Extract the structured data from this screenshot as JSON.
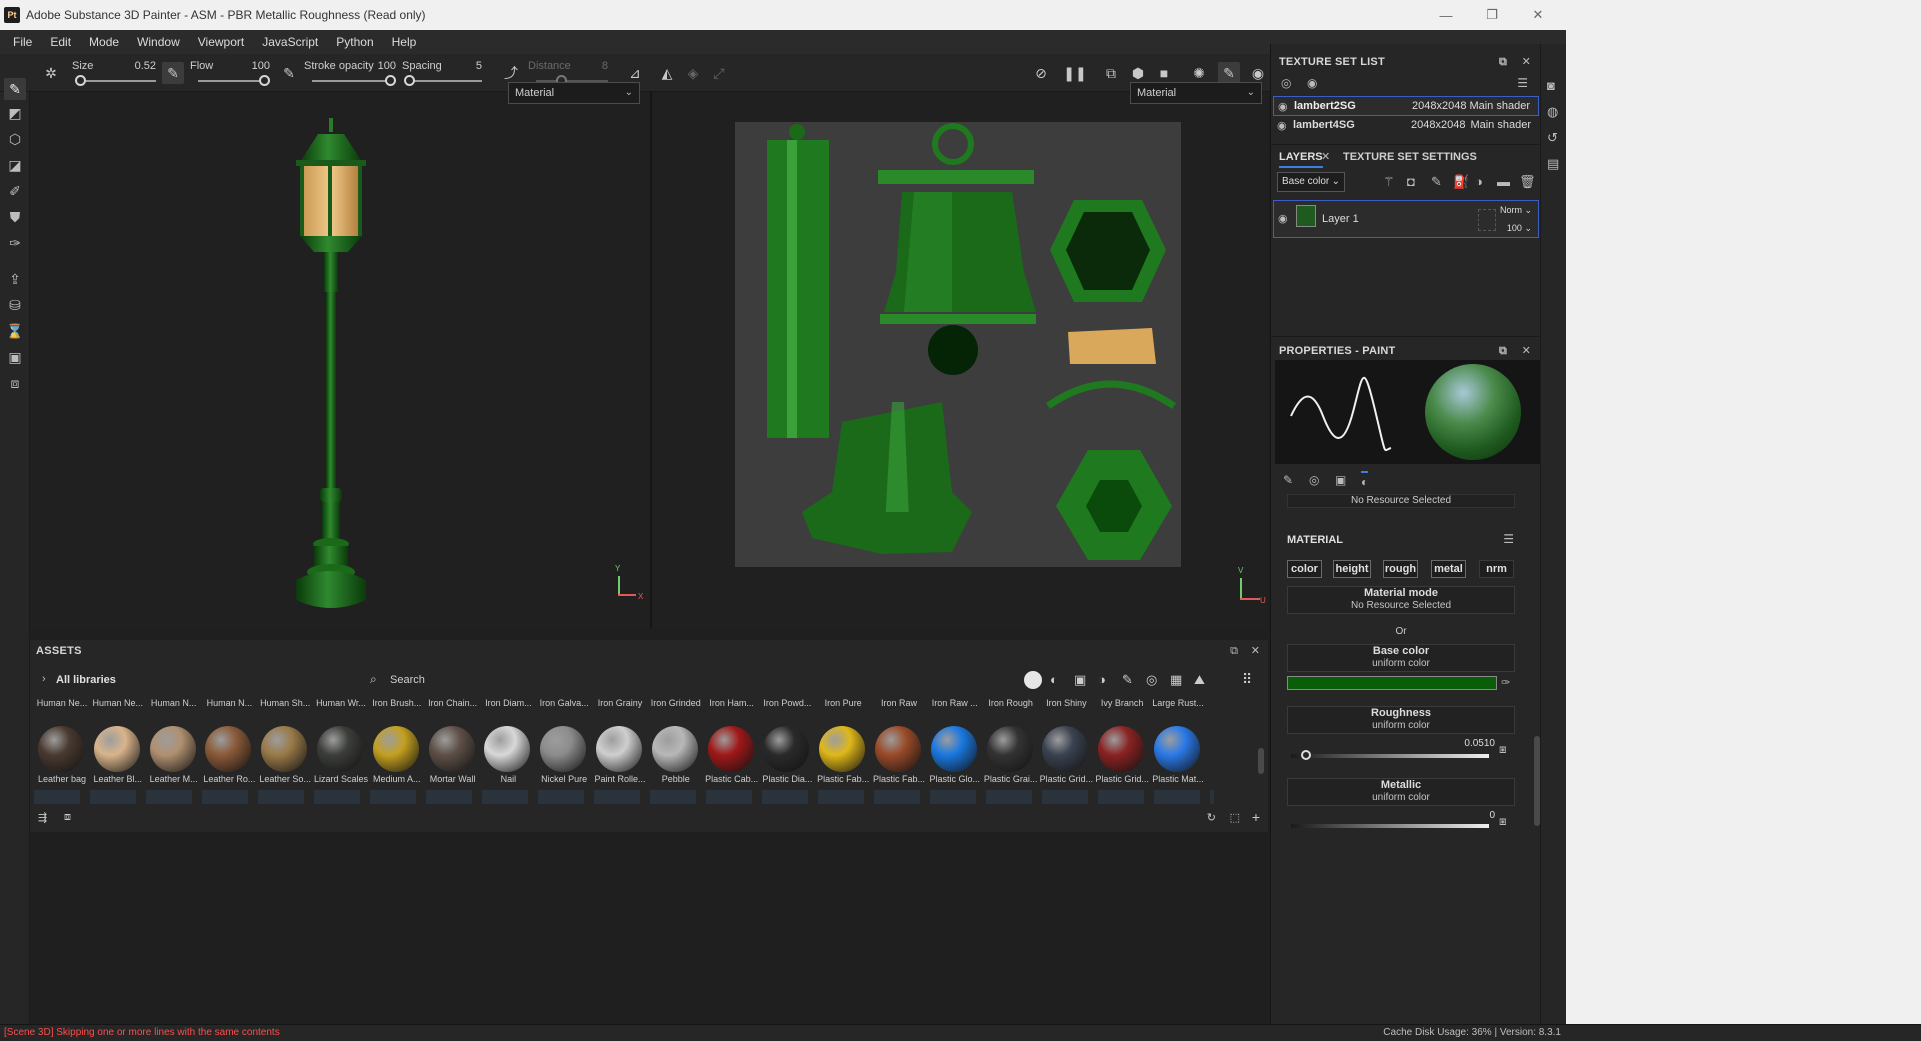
{
  "window": {
    "title": "Adobe Substance 3D Painter - ASM - PBR Metallic Roughness (Read only)",
    "logo": "Pt",
    "minimize": "—",
    "maximize": "❐",
    "close": "✕"
  },
  "menu": [
    "File",
    "Edit",
    "Mode",
    "Window",
    "Viewport",
    "JavaScript",
    "Python",
    "Help"
  ],
  "toolbar": {
    "size_label": "Size",
    "size_value": "0.52",
    "flow_label": "Flow",
    "flow_value": "100",
    "stroke_opacity_label": "Stroke opacity",
    "stroke_opacity_value": "100",
    "spacing_label": "Spacing",
    "spacing_value": "5",
    "distance_label": "Distance",
    "distance_value": "8"
  },
  "viewports": {
    "left_mode": "Material",
    "right_mode": "Material",
    "axis_y": "Y",
    "axis_x": "X",
    "axis_v": "V",
    "axis_u": "U"
  },
  "assets": {
    "title": "ASSETS",
    "library": "All libraries",
    "search_placeholder": "Search",
    "top_row": [
      "Human Ne...",
      "Human Ne...",
      "Human N...",
      "Human N...",
      "Human Sh...",
      "Human Wr...",
      "Iron Brush...",
      "Iron Chain...",
      "Iron Diam...",
      "Iron Galva...",
      "Iron Grainy",
      "Iron Grinded",
      "Iron Ham...",
      "Iron Powd...",
      "Iron Pure",
      "Iron Raw",
      "Iron Raw ...",
      "Iron Rough",
      "Iron Shiny",
      "Ivy Branch",
      "Large Rust..."
    ],
    "main_row": [
      {
        "name": "Leather bag",
        "color": "#4a3a30"
      },
      {
        "name": "Leather Bl...",
        "color": "#d9b48c"
      },
      {
        "name": "Leather M...",
        "color": "#b09070"
      },
      {
        "name": "Leather Ro...",
        "color": "#8a5a38"
      },
      {
        "name": "Leather So...",
        "color": "#9a7a48"
      },
      {
        "name": "Lizard Scales",
        "color": "#3c3e3a"
      },
      {
        "name": "Medium A...",
        "color": "#c4a020"
      },
      {
        "name": "Mortar Wall",
        "color": "#5e5048"
      },
      {
        "name": "Nail",
        "color": "#d8d8d8"
      },
      {
        "name": "Nickel Pure",
        "color": "#8c8c8c"
      },
      {
        "name": "Paint Rolle...",
        "color": "#cfcfcf"
      },
      {
        "name": "Pebble",
        "color": "#b8b8b8"
      },
      {
        "name": "Plastic Cab...",
        "color": "#a01818"
      },
      {
        "name": "Plastic Dia...",
        "color": "#2a2a2a"
      },
      {
        "name": "Plastic Fab...",
        "color": "#e0b818"
      },
      {
        "name": "Plastic Fab...",
        "color": "#9a4a28"
      },
      {
        "name": "Plastic Glo...",
        "color": "#1a78e0"
      },
      {
        "name": "Plastic Grai...",
        "color": "#333333"
      },
      {
        "name": "Plastic Grid...",
        "color": "#3a4250"
      },
      {
        "name": "Plastic Grid...",
        "color": "#8a2222"
      },
      {
        "name": "Plastic Mat...",
        "color": "#2a7ae8"
      }
    ]
  },
  "texture_set_list": {
    "title": "TEXTURE SET LIST",
    "sets": [
      {
        "name": "lambert2SG",
        "resolution": "2048x2048",
        "shader": "Main shader"
      },
      {
        "name": "lambert4SG",
        "resolution": "2048x2048",
        "shader": "Main shader"
      }
    ]
  },
  "layers": {
    "tab_layers": "LAYERS",
    "tab_settings": "TEXTURE SET SETTINGS",
    "channel": "Base color",
    "layer_name": "Layer 1",
    "blend_mode": "Norm",
    "opacity": "100"
  },
  "properties": {
    "title": "PROPERTIES - PAINT",
    "no_resource_top": "No Resource Selected",
    "material_title": "MATERIAL",
    "channel_buttons": [
      "color",
      "height",
      "rough",
      "metal",
      "nrm"
    ],
    "material_mode_title": "Material mode",
    "material_mode_value": "No Resource Selected",
    "or": "Or",
    "base_color_title": "Base color",
    "base_color_sub": "uniform color",
    "base_color_hex": "#0a5e0a",
    "roughness_title": "Roughness",
    "roughness_sub": "uniform color",
    "roughness_value": "0.0510",
    "metallic_title": "Metallic",
    "metallic_sub": "uniform color",
    "metallic_value": "0"
  },
  "status": {
    "message": "[Scene 3D] Skipping one or more lines with the same contents",
    "info": "Cache Disk Usage:   36% | Version: 8.3.1"
  }
}
